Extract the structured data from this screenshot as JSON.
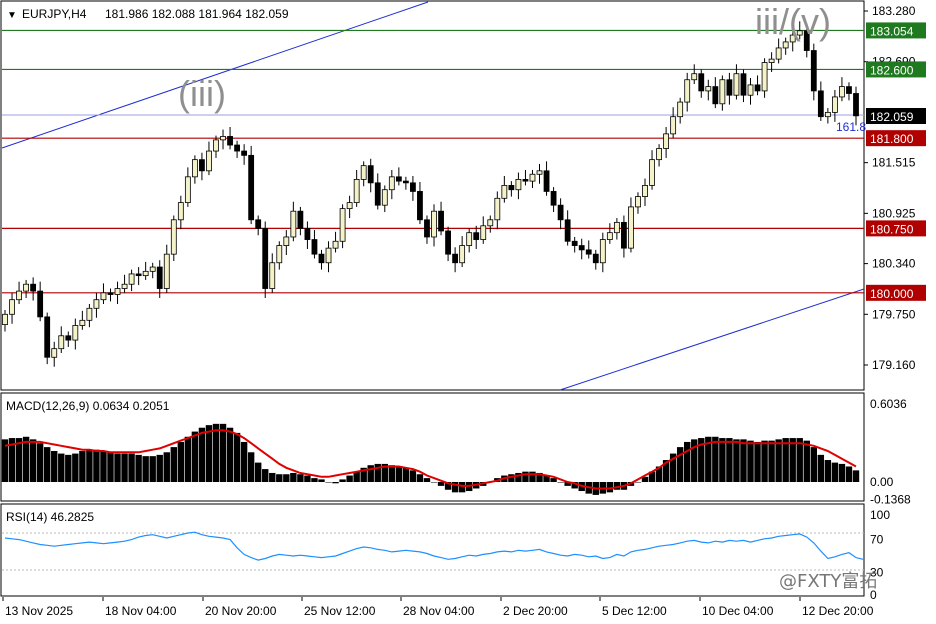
{
  "header": {
    "symbol": "EURJPY,H4",
    "ohlc": "181.986 182.088 181.964 182.059"
  },
  "watermark": "@FXTY富拓",
  "wave_labels": {
    "left": "(iii)",
    "right": "iii/(v)"
  },
  "fib_label": "161.8",
  "price_axis": {
    "ticks": [
      "183.280",
      "182.690",
      "181.515",
      "180.925",
      "180.340",
      "179.750",
      "179.160"
    ],
    "tick_values": [
      183.28,
      182.69,
      181.515,
      180.925,
      180.34,
      179.75,
      179.16
    ],
    "current_price": "182.059",
    "levels": [
      {
        "label": "183.054",
        "value": 183.054,
        "type": "resistance",
        "color": "#1f7a1f"
      },
      {
        "label": "182.600",
        "value": 182.6,
        "type": "resistance",
        "color": "#1f7a1f"
      },
      {
        "label": "181.800",
        "value": 181.8,
        "type": "support",
        "color": "#b00000"
      },
      {
        "label": "180.750",
        "value": 180.75,
        "type": "support",
        "color": "#b00000"
      },
      {
        "label": "180.000",
        "value": 180.0,
        "type": "support",
        "color": "#b00000"
      }
    ]
  },
  "time_axis": {
    "labels": [
      "13 Nov 2025",
      "18 Nov 04:00",
      "20 Nov 20:00",
      "25 Nov 12:00",
      "28 Nov 04:00",
      "2 Dec 20:00",
      "5 Dec 12:00",
      "10 Dec 04:00",
      "12 Dec 20:00"
    ]
  },
  "macd": {
    "title": "MACD(12,26,9) 0.0634 0.2051",
    "ticks": [
      "0.6036",
      "0.00",
      "-0.1368"
    ],
    "tick_values": [
      0.6036,
      0.0,
      -0.1368
    ],
    "signal_color": "#e00000"
  },
  "rsi": {
    "title": "RSI(14) 46.2825",
    "ticks": [
      "100",
      "70",
      "30",
      "0"
    ],
    "tick_values": [
      100,
      70,
      30,
      0
    ],
    "line_color": "#1e90ff"
  },
  "chart_data": {
    "type": "candlestick",
    "title": "EURJPY,H4",
    "ylim": [
      178.75,
      183.38
    ],
    "closes": [
      179.75,
      179.92,
      180.02,
      180.1,
      180.02,
      179.72,
      179.25,
      179.35,
      179.5,
      179.45,
      179.62,
      179.68,
      179.82,
      179.92,
      180.0,
      179.98,
      180.05,
      180.1,
      180.22,
      180.2,
      180.25,
      180.3,
      180.05,
      180.45,
      180.85,
      181.05,
      181.35,
      181.55,
      181.42,
      181.65,
      181.78,
      181.82,
      181.72,
      181.65,
      181.6,
      180.85,
      180.75,
      180.05,
      180.35,
      180.55,
      180.65,
      180.95,
      180.75,
      180.62,
      180.45,
      180.35,
      180.52,
      180.6,
      180.98,
      181.05,
      181.32,
      181.48,
      181.28,
      181.02,
      181.2,
      181.35,
      181.3,
      181.28,
      181.18,
      180.85,
      180.65,
      180.95,
      180.72,
      180.45,
      180.35,
      180.55,
      180.7,
      180.62,
      180.78,
      180.85,
      181.1,
      181.25,
      181.2,
      181.32,
      181.3,
      181.38,
      181.42,
      181.18,
      181.02,
      180.85,
      180.6,
      180.55,
      180.5,
      180.45,
      180.35,
      180.62,
      180.7,
      180.82,
      180.52,
      181.0,
      181.12,
      181.25,
      181.55,
      181.68,
      181.85,
      182.05,
      182.22,
      182.48,
      182.55,
      182.35,
      182.4,
      182.2,
      182.48,
      182.3,
      182.55,
      182.3,
      182.42,
      182.35,
      182.68,
      182.72,
      182.85,
      182.92,
      183.0,
      183.05,
      182.82,
      182.35,
      182.05,
      182.1,
      182.28,
      182.4,
      182.32,
      182.06
    ],
    "macd_hist": [
      0.33,
      0.34,
      0.34,
      0.35,
      0.33,
      0.3,
      0.27,
      0.24,
      0.22,
      0.21,
      0.22,
      0.24,
      0.25,
      0.25,
      0.24,
      0.23,
      0.22,
      0.22,
      0.22,
      0.21,
      0.2,
      0.2,
      0.21,
      0.23,
      0.27,
      0.31,
      0.35,
      0.39,
      0.42,
      0.44,
      0.45,
      0.45,
      0.42,
      0.38,
      0.31,
      0.23,
      0.15,
      0.1,
      0.07,
      0.06,
      0.06,
      0.07,
      0.06,
      0.05,
      0.03,
      0.02,
      0.0,
      -0.01,
      0.02,
      0.05,
      0.08,
      0.11,
      0.13,
      0.14,
      0.14,
      0.13,
      0.12,
      0.11,
      0.09,
      0.06,
      0.03,
      0.0,
      -0.03,
      -0.06,
      -0.08,
      -0.08,
      -0.07,
      -0.05,
      -0.03,
      0.0,
      0.03,
      0.05,
      0.06,
      0.07,
      0.08,
      0.08,
      0.07,
      0.05,
      0.03,
      0.0,
      -0.03,
      -0.05,
      -0.07,
      -0.09,
      -0.1,
      -0.09,
      -0.08,
      -0.06,
      -0.06,
      -0.03,
      0.0,
      0.04,
      0.08,
      0.12,
      0.17,
      0.22,
      0.27,
      0.31,
      0.33,
      0.34,
      0.35,
      0.35,
      0.34,
      0.34,
      0.33,
      0.33,
      0.32,
      0.31,
      0.32,
      0.32,
      0.33,
      0.34,
      0.34,
      0.34,
      0.32,
      0.27,
      0.21,
      0.17,
      0.15,
      0.14,
      0.12,
      0.09
    ],
    "macd_signal": [
      0.28,
      0.29,
      0.3,
      0.31,
      0.31,
      0.31,
      0.3,
      0.29,
      0.28,
      0.27,
      0.26,
      0.25,
      0.25,
      0.24,
      0.24,
      0.23,
      0.23,
      0.23,
      0.23,
      0.23,
      0.24,
      0.25,
      0.26,
      0.28,
      0.3,
      0.32,
      0.34,
      0.36,
      0.38,
      0.39,
      0.4,
      0.4,
      0.39,
      0.37,
      0.34,
      0.3,
      0.26,
      0.22,
      0.18,
      0.14,
      0.11,
      0.09,
      0.07,
      0.06,
      0.05,
      0.04,
      0.04,
      0.05,
      0.06,
      0.07,
      0.08,
      0.09,
      0.1,
      0.11,
      0.12,
      0.12,
      0.12,
      0.11,
      0.1,
      0.08,
      0.05,
      0.03,
      0.01,
      -0.01,
      -0.02,
      -0.03,
      -0.03,
      -0.02,
      -0.01,
      0.0,
      0.01,
      0.03,
      0.04,
      0.05,
      0.06,
      0.06,
      0.06,
      0.05,
      0.04,
      0.02,
      0.0,
      -0.01,
      -0.03,
      -0.04,
      -0.05,
      -0.05,
      -0.05,
      -0.04,
      -0.03,
      -0.01,
      0.02,
      0.05,
      0.08,
      0.11,
      0.15,
      0.18,
      0.21,
      0.24,
      0.27,
      0.29,
      0.3,
      0.31,
      0.31,
      0.31,
      0.31,
      0.3,
      0.3,
      0.3,
      0.3,
      0.3,
      0.3,
      0.3,
      0.3,
      0.3,
      0.29,
      0.28,
      0.26,
      0.24,
      0.21,
      0.18,
      0.15,
      0.12
    ],
    "rsi": [
      72,
      71,
      70,
      68,
      66,
      64,
      63,
      62,
      63,
      64,
      65,
      66,
      67,
      66,
      65,
      66,
      67,
      68,
      70,
      73,
      75,
      76,
      74,
      72,
      74,
      76,
      78,
      79,
      76,
      74,
      73,
      72,
      70,
      60,
      52,
      48,
      45,
      47,
      50,
      52,
      51,
      50,
      51,
      50,
      49,
      48,
      49,
      50,
      53,
      56,
      59,
      61,
      60,
      58,
      57,
      55,
      56,
      57,
      56,
      55,
      53,
      50,
      48,
      46,
      47,
      49,
      51,
      50,
      52,
      53,
      55,
      56,
      55,
      57,
      56,
      57,
      58,
      55,
      53,
      51,
      50,
      52,
      51,
      49,
      50,
      47,
      48,
      52,
      50,
      55,
      57,
      58,
      60,
      62,
      63,
      64,
      66,
      68,
      69,
      67,
      66,
      68,
      67,
      69,
      68,
      69,
      67,
      69,
      71,
      72,
      74,
      75,
      76,
      77,
      73,
      66,
      56,
      47,
      49,
      52,
      54,
      48,
      46
    ]
  }
}
